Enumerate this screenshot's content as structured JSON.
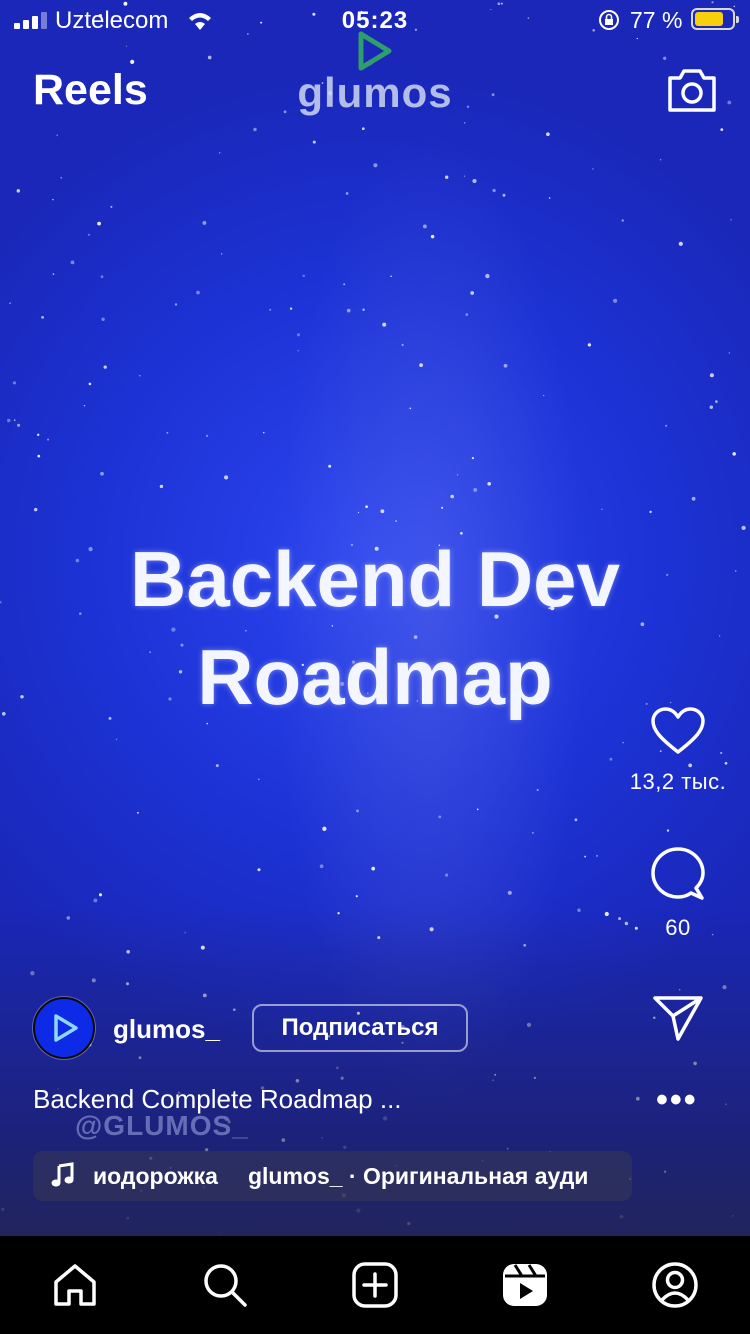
{
  "status_bar": {
    "carrier": "Uztelecom",
    "time": "05:23",
    "battery_percent": "77 %",
    "battery_level": 0.77,
    "battery_color": "#f7cf0c"
  },
  "header": {
    "title": "Reels",
    "brand": "glumos",
    "camera_icon": "camera-icon"
  },
  "video": {
    "headline_line1": "Backend Dev",
    "headline_line2": "Roadmap",
    "watermark": "@GLUMOS_"
  },
  "actions": {
    "likes": "13,2 тыс.",
    "comments": "60",
    "icons": [
      "heart-icon",
      "comment-icon",
      "share-icon",
      "more-icon"
    ]
  },
  "post": {
    "username": "glumos_",
    "follow_label": "Подписаться",
    "caption": "Backend Complete Roadmap ...",
    "audio_left": "иодорожка",
    "audio_right": "glumos_ · Оригинальная ауди"
  },
  "tabbar": {
    "icons": [
      "home-icon",
      "search-icon",
      "create-icon",
      "reels-icon",
      "profile-icon"
    ]
  },
  "colors": {
    "background": "#1d33d6",
    "accent": "#0d2be6"
  }
}
